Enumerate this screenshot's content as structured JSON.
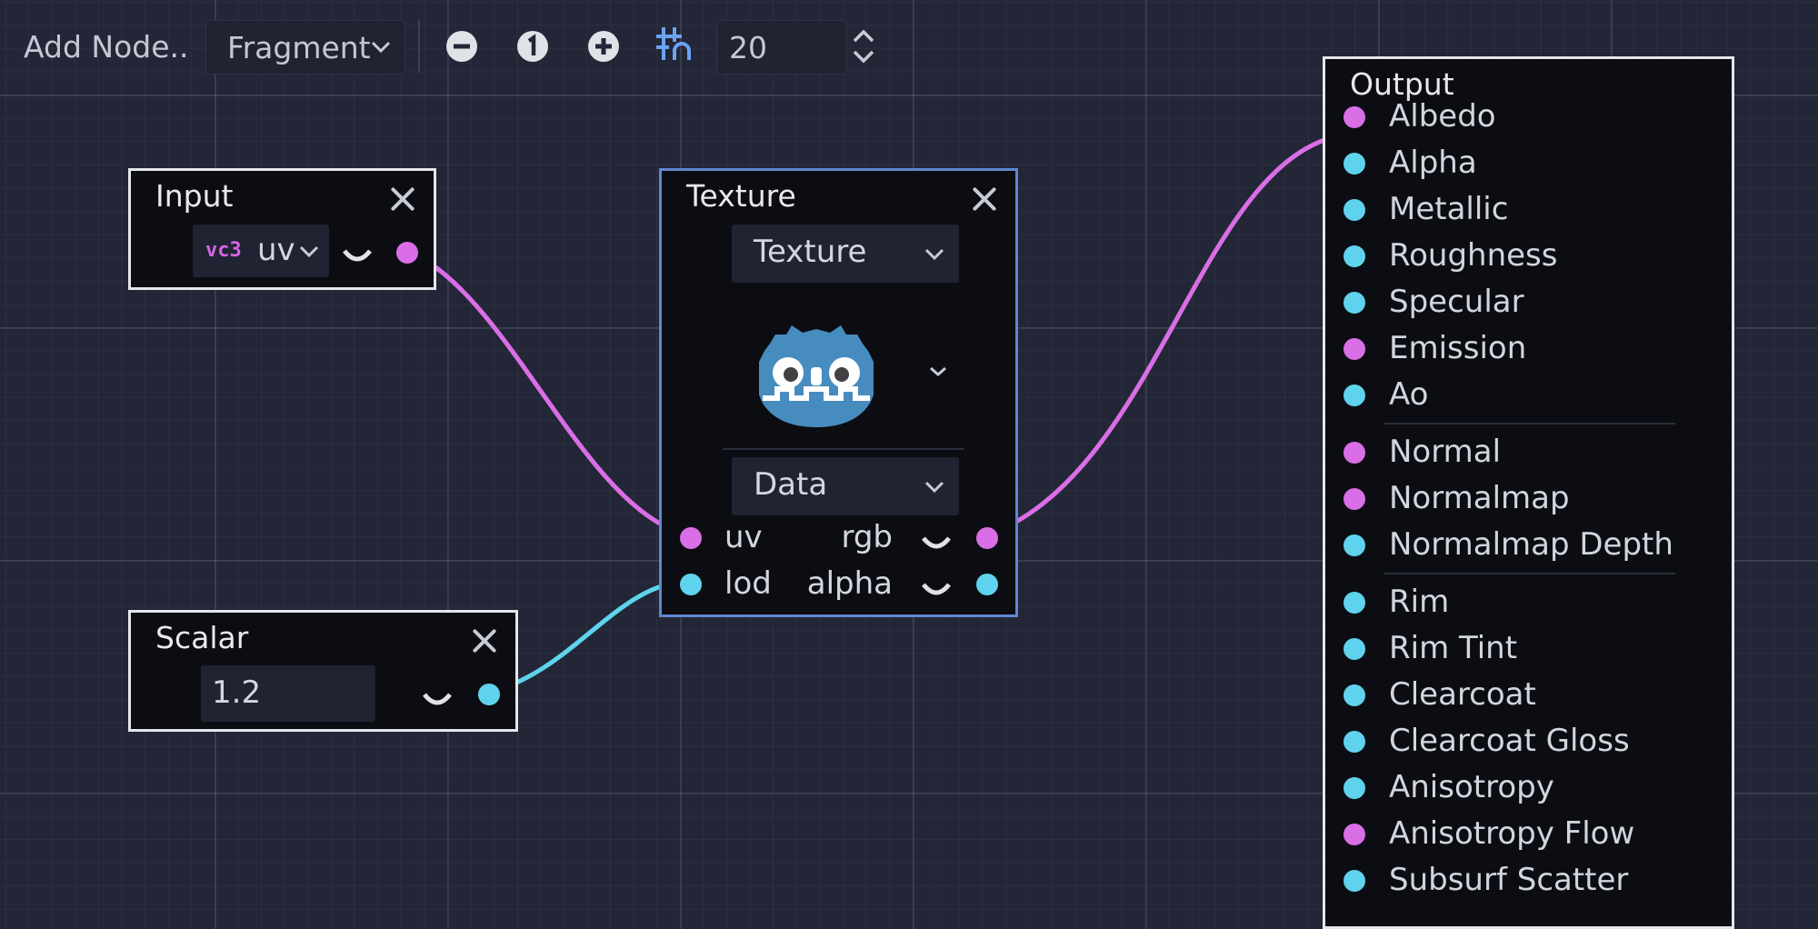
{
  "toolbar": {
    "add_node_label": "Add Node..",
    "shader_mode": "Fragment",
    "zoom_out_icon": "minus-circle-icon",
    "zoom_reset_icon": "one-circle-icon",
    "zoom_in_icon": "plus-circle-icon",
    "snap_icon": "grid-snap-icon",
    "snap_value": "20"
  },
  "nodes": {
    "input": {
      "title": "Input",
      "type_badge": "vc3",
      "selected_input": "uv"
    },
    "scalar": {
      "title": "Scalar",
      "value": "1.2"
    },
    "texture": {
      "title": "Texture",
      "source": "Texture",
      "texture_type": "Data",
      "preview_icon": "godot-logo-icon",
      "inputs": [
        "uv",
        "lod"
      ],
      "outputs": [
        "rgb",
        "alpha"
      ]
    },
    "output": {
      "title": "Output",
      "ports": [
        {
          "name": "Albedo",
          "kind": "vector"
        },
        {
          "name": "Alpha",
          "kind": "scalar"
        },
        {
          "name": "Metallic",
          "kind": "scalar"
        },
        {
          "name": "Roughness",
          "kind": "scalar"
        },
        {
          "name": "Specular",
          "kind": "scalar"
        },
        {
          "name": "Emission",
          "kind": "vector"
        },
        {
          "name": "Ao",
          "kind": "scalar"
        },
        {
          "name": "Normal",
          "kind": "vector"
        },
        {
          "name": "Normalmap",
          "kind": "vector"
        },
        {
          "name": "Normalmap Depth",
          "kind": "scalar"
        },
        {
          "name": "Rim",
          "kind": "scalar"
        },
        {
          "name": "Rim Tint",
          "kind": "scalar"
        },
        {
          "name": "Clearcoat",
          "kind": "scalar"
        },
        {
          "name": "Clearcoat Gloss",
          "kind": "scalar"
        },
        {
          "name": "Anisotropy",
          "kind": "scalar"
        },
        {
          "name": "Anisotropy Flow",
          "kind": "vector"
        },
        {
          "name": "Subsurf Scatter",
          "kind": "scalar"
        }
      ]
    }
  },
  "colors": {
    "vector_port": "#da6ee6",
    "scalar_port": "#5fd3ee",
    "selected_border": "#5f87d0",
    "node_border": "#e4e6ec"
  }
}
